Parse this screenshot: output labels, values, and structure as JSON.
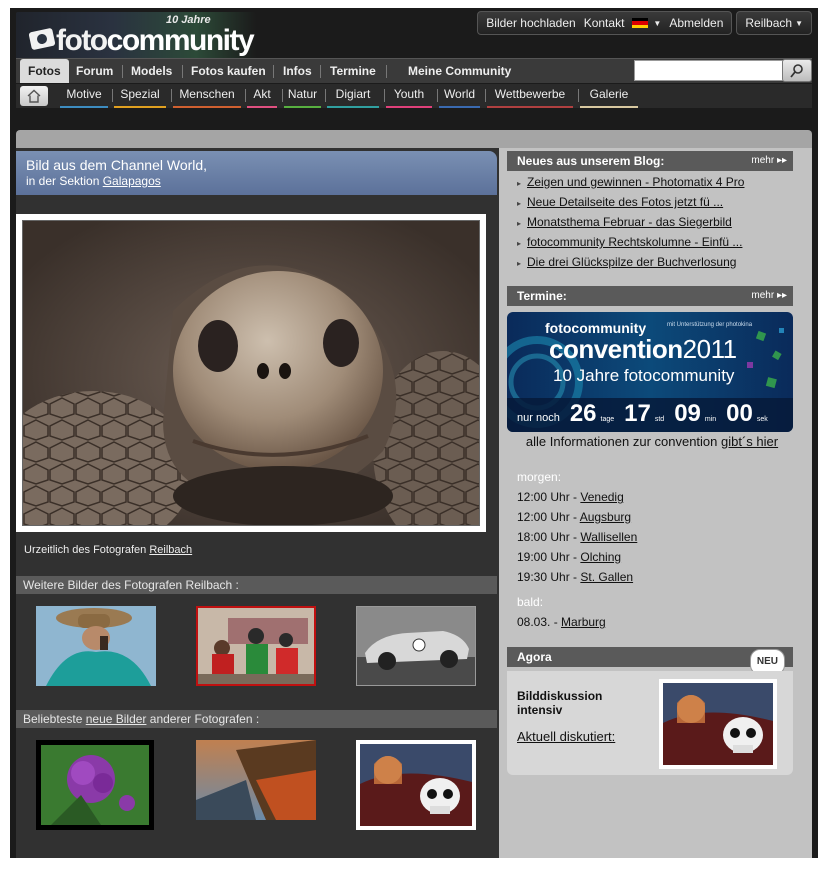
{
  "logo": {
    "anniversary": "10 Jahre",
    "brand_a": "foto",
    "brand_b": "community"
  },
  "topbar": {
    "upload": "Bilder hochladen",
    "contact": "Kontakt",
    "logout": "Abmelden",
    "user": "Reilbach"
  },
  "nav": {
    "main": [
      "Fotos",
      "Forum",
      "Models",
      "Fotos kaufen",
      "Infos",
      "Termine",
      "Meine Community"
    ],
    "search_placeholder": "",
    "sub": [
      "Motive",
      "Spezial",
      "Menschen",
      "Akt",
      "Natur",
      "Digiart",
      "Youth",
      "World",
      "Wettbewerbe",
      "Galerie"
    ],
    "sub_colors": [
      "#3d8cc0",
      "#e0a020",
      "#d06030",
      "#e05080",
      "#58b040",
      "#30a0a0",
      "#e0407a",
      "#3a6ab0",
      "#b04040",
      "#d8c8a0"
    ]
  },
  "feature": {
    "title": "Bild aus dem Channel World,",
    "section_prefix": "in der Sektion ",
    "section_link": "Galapagos",
    "credit_prefix": "Urzeitlich des Fotografen ",
    "credit_link": "Reilbach"
  },
  "more_by_photographer": "Weitere Bilder des Fotografen Reilbach :",
  "popular": {
    "prefix": "Beliebteste ",
    "link": "neue Bilder",
    "suffix": " anderer Fotografen :"
  },
  "blog": {
    "title": "Neues aus unserem Blog:",
    "more": "mehr",
    "items": [
      "Zeigen und gewinnen - Photomatix 4 Pro",
      "Neue Detailseite des Fotos jetzt fü ...",
      "Monatsthema Februar - das Siegerbild",
      "fotocommunity Rechtskolumne - Einfü ...",
      "Die drei Glückspilze der Buchverlosung"
    ]
  },
  "termine": {
    "title": "Termine:",
    "more": "mehr",
    "banner": {
      "brand": "fotocommunity",
      "support": "mit Unterstützung der photokina",
      "event": "convention",
      "year": "2011",
      "tagline": "10 Jahre fotocommunity",
      "countdown_prefix": "nur noch",
      "days": "26",
      "days_unit": "tage",
      "hours": "17",
      "hours_unit": "std",
      "mins": "09",
      "mins_unit": "min",
      "secs": "00",
      "secs_unit": "sek"
    },
    "info_prefix": "alle Informationen zur convention ",
    "info_link": "gibt´s hier",
    "tomorrow_label": "morgen:",
    "tomorrow": [
      {
        "time": "12:00 Uhr - ",
        "place": "Venedig"
      },
      {
        "time": "12:00 Uhr - ",
        "place": "Augsburg"
      },
      {
        "time": "18:00 Uhr - ",
        "place": "Wallisellen"
      },
      {
        "time": "19:00 Uhr - ",
        "place": "Olching"
      },
      {
        "time": "19:30 Uhr - ",
        "place": "St. Gallen"
      }
    ],
    "soon_label": "bald:",
    "soon": [
      {
        "time": "08.03. - ",
        "place": "Marburg"
      }
    ]
  },
  "agora": {
    "title": "Agora",
    "badge": "NEU",
    "heading": "Bilddiskussion intensiv",
    "link": "Aktuell diskutiert:"
  }
}
